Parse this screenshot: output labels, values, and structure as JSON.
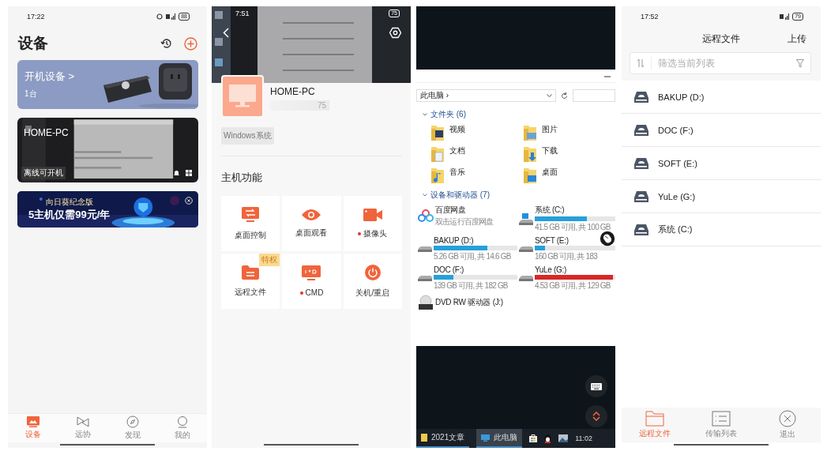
{
  "devices_screen": {
    "status_bar": {
      "time": "17:22",
      "battery": "88"
    },
    "title": "设备",
    "power_card": {
      "title": "开机设备 >",
      "count": "1台"
    },
    "device_card": {
      "name": "HOME-PC",
      "status": "离线可开机"
    },
    "banner": {
      "line_1": "向日葵纪念版",
      "line_2": "5主机仅需99元/年"
    },
    "tab_bar": [
      {
        "label": "设备",
        "kind": "devices",
        "selected": true
      },
      {
        "label": "远协",
        "kind": "remote",
        "selected": false
      },
      {
        "label": "发现",
        "kind": "discover",
        "selected": false
      },
      {
        "label": "我的",
        "kind": "me",
        "selected": false
      }
    ]
  },
  "host_screen": {
    "status_bar": {
      "time": "7:51",
      "battery": "75"
    },
    "name": "HOME-PC",
    "address": "75",
    "os_tag": "Windows系统",
    "section_title": "主机功能",
    "functions": [
      {
        "label": "桌面控制",
        "kind": "control",
        "dot": false
      },
      {
        "label": "桌面观看",
        "kind": "eye",
        "dot": false
      },
      {
        "label": "摄像头",
        "kind": "camera",
        "dot": true
      },
      {
        "label": "远程文件",
        "kind": "folder",
        "dot": false,
        "badge": "特权"
      },
      {
        "label": "CMD",
        "kind": "cmd",
        "dot": true
      },
      {
        "label": "关机/重启",
        "kind": "power",
        "dot": false
      }
    ]
  },
  "remote_desktop_screen": {
    "explorer": {
      "path": "此电脑 ›",
      "folders_heading": "文件夹 (6)",
      "folders": [
        {
          "name": "视频",
          "kind": "video"
        },
        {
          "name": "图片",
          "kind": "pictures"
        },
        {
          "name": "文档",
          "kind": "documents"
        },
        {
          "name": "下载",
          "kind": "downloads"
        },
        {
          "name": "音乐",
          "kind": "music"
        },
        {
          "name": "桌面",
          "kind": "desktop"
        }
      ],
      "drives_heading": "设备和驱动器 (7)",
      "drives": [
        {
          "kind": "cloud",
          "name": "百度网盘",
          "detail": "双击运行百度网盘"
        },
        {
          "kind": "system",
          "name": "系统 (C:)",
          "level": 0.65,
          "full": false,
          "detail": "41.5 GB 可用, 共 100 GB"
        },
        {
          "kind": "disk",
          "name": "BAKUP (D:)",
          "level": 0.64,
          "full": false,
          "detail": "5.26 GB 可用, 共 14.6 GB"
        },
        {
          "kind": "disk",
          "name": "SOFT (E:)",
          "level": 0.13,
          "full": false,
          "detail": "160 GB 可用, 共 183"
        },
        {
          "kind": "disk",
          "name": "DOC (F:)",
          "level": 0.24,
          "full": false,
          "detail": "139 GB 可用, 共 182 GB"
        },
        {
          "kind": "disk",
          "name": "YuLe (G:)",
          "level": 0.97,
          "full": true,
          "detail": "4.53 GB 可用, 共 129 GB"
        },
        {
          "kind": "dvd",
          "name": "DVD RW 驱动器 (J:)"
        }
      ]
    },
    "taskbar": {
      "items": [
        {
          "label": "2021文章",
          "kind": "folder",
          "selected": false
        },
        {
          "label": "此电脑",
          "kind": "pc",
          "selected": true
        }
      ],
      "clock": "11:02"
    }
  },
  "remote_files_screen": {
    "status_bar": {
      "time": "17:52",
      "battery": "79"
    },
    "title": "远程文件",
    "upload": "上传",
    "filter_placeholder": "筛选当前列表",
    "drives": [
      "BAKUP (D:)",
      "DOC (F:)",
      "SOFT (E:)",
      "YuLe (G:)",
      "系统 (C:)"
    ],
    "tab_bar": [
      {
        "label": "远程文件",
        "kind": "folder",
        "selected": true
      },
      {
        "label": "传输列表",
        "kind": "list",
        "selected": false
      },
      {
        "label": "退出",
        "kind": "exit",
        "selected": false
      }
    ]
  }
}
